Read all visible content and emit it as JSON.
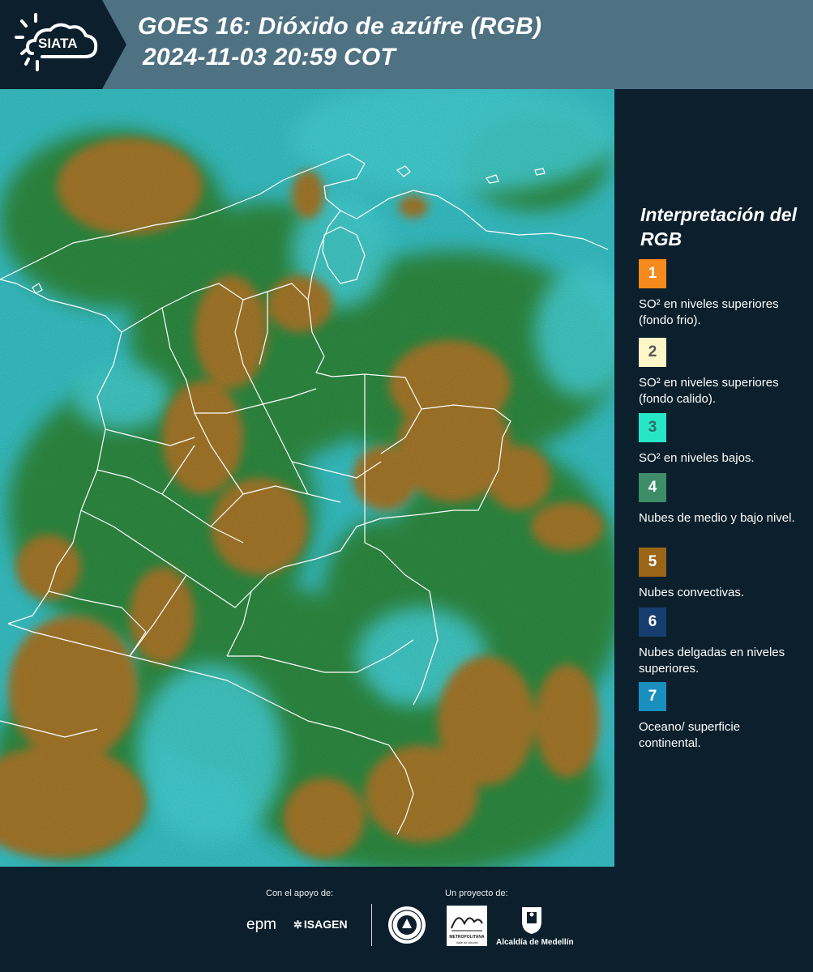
{
  "header": {
    "logo_text": "SIATA",
    "title_line1": "GOES 16: Dióxido de azúfre (RGB)",
    "title_line2": "2024-11-03 20:59 COT"
  },
  "legend": {
    "title": "Interpretación del RGB",
    "items": [
      {
        "number": "1",
        "label": "SO² en niveles superiores (fondo frio).",
        "color": "#f78a1d",
        "number_color": "#ffffff"
      },
      {
        "number": "2",
        "label": "SO² en niveles superiores (fondo calido).",
        "color": "#fdf7c8",
        "number_color": "#555555"
      },
      {
        "number": "3",
        "label": "SO² en niveles bajos.",
        "color": "#27e6c6",
        "number_color": "#2a6a6a"
      },
      {
        "number": "4",
        "label": "Nubes de medio y bajo nivel.",
        "color": "#3d8d68",
        "number_color": "#ffffff"
      },
      {
        "number": "5",
        "label": "Nubes convectivas.",
        "color": "#9a6516",
        "number_color": "#ffffff"
      },
      {
        "number": "6",
        "label": "Nubes delgadas en niveles superiores.",
        "color": "#163e6e",
        "number_color": "#ffffff"
      },
      {
        "number": "7",
        "label": "Oceano/ superficie continental.",
        "color": "#1a8fbf",
        "number_color": "#ffffff"
      }
    ]
  },
  "footer": {
    "support_label": "Con el apoyo de:",
    "project_label": "Un proyecto de:",
    "sponsor_epm": "epm",
    "sponsor_isagen": "ISAGEN",
    "metropolitana_text": "METROPOLITANA",
    "metropolitana_sub": "Valle de Aburrá",
    "alcaldia": "Alcaldía de Medellín"
  },
  "colors": {
    "header_bg": "#4f7283",
    "panel_bg": "#0c1f2c",
    "cloud_brown": "#a77a2a",
    "vegetation_green": "#2f8a3a",
    "ocean_cyan": "#35c8d0"
  }
}
